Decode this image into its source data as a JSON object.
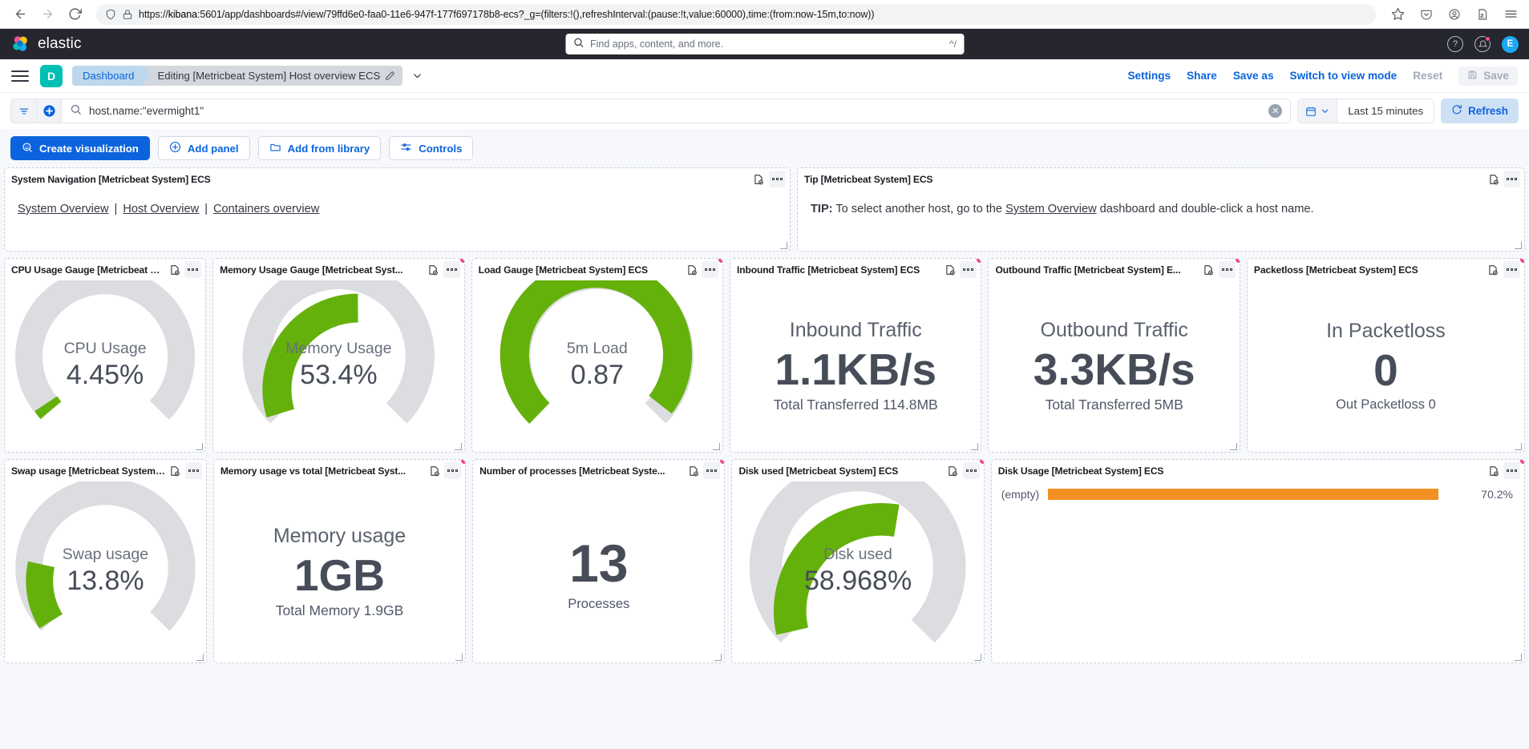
{
  "browser": {
    "url_prefix": "https://",
    "url_host": "kibana",
    "url_rest": ":5601/app/dashboards#/view/79ffd6e0-faa0-11e6-947f-177f697178b8-ecs?_g=(filters:!(),refreshInterval:(pause:!t,value:60000),time:(from:now-15m,to:now))",
    "back_icon": "back-arrow-icon",
    "forward_icon": "forward-arrow-icon",
    "reload_icon": "reload-icon",
    "shield_icon": "shield-icon",
    "lock_warning_icon": "lock-warning-icon",
    "bookmark_icon": "star-icon",
    "pocket_icon": "pocket-icon",
    "account_icon": "account-icon",
    "extensions_icon": "extensions-icon",
    "menu_icon": "hamburger-menu-icon"
  },
  "topbar": {
    "brand": "elastic",
    "search_placeholder": "Find apps, content, and more.",
    "search_shortcut": "^/",
    "help_icon": "help-circle-icon",
    "alerts_icon": "bell-icon",
    "avatar_initial": "E"
  },
  "breadcrumb": {
    "space_initial": "D",
    "first": "Dashboard",
    "last": "Editing [Metricbeat System] Host overview ECS",
    "edit_icon": "pencil-icon",
    "chevron_icon": "chevron-down-icon"
  },
  "topnav": {
    "settings": "Settings",
    "share": "Share",
    "save_as": "Save as",
    "switch_mode": "Switch to view mode",
    "reset": "Reset",
    "save": "Save",
    "save_icon": "floppy-disk-icon"
  },
  "querybar": {
    "filter_icon": "filter-icon",
    "add_filter_icon": "plus-circle-icon",
    "search_icon": "search-icon",
    "query": "host.name:\"evermight1\"",
    "clear_icon": "clear-x-icon",
    "calendar_icon": "calendar-icon",
    "date_range": "Last 15 minutes",
    "refresh_icon": "refresh-icon",
    "refresh_label": "Refresh"
  },
  "toolbar": {
    "create_visualization": "Create visualization",
    "create_icon": "lens-icon",
    "add_panel": "Add panel",
    "add_panel_icon": "plus-circle-icon",
    "add_from_library": "Add from library",
    "add_library_icon": "folder-icon",
    "controls": "Controls",
    "controls_icon": "sliders-icon"
  },
  "panel_icons": {
    "library_icon": "saved-object-icon",
    "context_menu_icon": "ellipsis-icon",
    "resize_icon": "resize-handle-icon",
    "drag_dot_icon": "drag-indicator-dot"
  },
  "colors": {
    "gauge_fill": "#65b10b",
    "gauge_track": "#dcdde1",
    "bar_fill": "#f29022",
    "accent_blue": "#0b64dd",
    "pink_dot": "#f7447f",
    "space_teal": "#00bfb3"
  },
  "panels": {
    "system_navigation": {
      "title": "System Navigation [Metricbeat System] ECS",
      "links": [
        "System Overview",
        "Host Overview",
        "Containers overview"
      ],
      "separator": "|"
    },
    "tip": {
      "title": "Tip [Metricbeat System] ECS",
      "prefix": "TIP:",
      "text_before": " To select another host, go to the ",
      "link": "System Overview",
      "text_after": " dashboard and double-click a host name."
    },
    "cpu_gauge": {
      "title": "CPU Usage Gauge [Metricbeat System] ...",
      "label": "CPU Usage",
      "value": "4.45%"
    },
    "memory_gauge": {
      "title": "Memory Usage Gauge [Metricbeat Syst...",
      "label": "Memory Usage",
      "value": "53.4%"
    },
    "load_gauge": {
      "title": "Load Gauge [Metricbeat System] ECS",
      "label": "5m Load",
      "value": "0.87"
    },
    "inbound_traffic": {
      "title": "Inbound Traffic [Metricbeat System] ECS",
      "label": "Inbound Traffic",
      "value": "1.1KB/s",
      "sub_prefix": "Total Transferred",
      "sub_value": "114.8MB"
    },
    "outbound_traffic": {
      "title": "Outbound Traffic [Metricbeat System] E...",
      "label": "Outbound Traffic",
      "value": "3.3KB/s",
      "sub_prefix": "Total Transferred",
      "sub_value": "5MB"
    },
    "packetloss": {
      "title": "Packetloss [Metricbeat System] ECS",
      "label": "In Packetloss",
      "value": "0",
      "sub": "Out Packetloss 0"
    },
    "swap_usage": {
      "title": "Swap usage [Metricbeat System] ECS",
      "label": "Swap usage",
      "value": "13.8%"
    },
    "memory_vs_total": {
      "title": "Memory usage vs total [Metricbeat Syst...",
      "label": "Memory usage",
      "value": "1GB",
      "sub_prefix": "Total Memory",
      "sub_value": "1.9GB"
    },
    "processes": {
      "title": "Number of processes [Metricbeat Syste...",
      "value": "13",
      "sub": "Processes"
    },
    "disk_used": {
      "title": "Disk used [Metricbeat System] ECS",
      "label": "Disk used",
      "value": "58.968%"
    },
    "disk_usage": {
      "title": "Disk Usage [Metricbeat System] ECS",
      "category": "(empty)",
      "percent_label": "70.2%"
    }
  },
  "chart_data": [
    {
      "type": "gauge",
      "title": "CPU Usage Gauge [Metricbeat System] ECS",
      "label": "CPU Usage",
      "value": 4.45,
      "unit": "%",
      "min": 0,
      "max": 100
    },
    {
      "type": "gauge",
      "title": "Memory Usage Gauge [Metricbeat System] ECS",
      "label": "Memory Usage",
      "value": 53.4,
      "unit": "%",
      "min": 0,
      "max": 100
    },
    {
      "type": "gauge",
      "title": "Load Gauge [Metricbeat System] ECS",
      "label": "5m Load",
      "value": 0.87,
      "unit": "",
      "min": 0,
      "max": 1
    },
    {
      "type": "gauge",
      "title": "Swap usage [Metricbeat System] ECS",
      "label": "Swap usage",
      "value": 13.8,
      "unit": "%",
      "min": 0,
      "max": 100
    },
    {
      "type": "gauge",
      "title": "Disk used [Metricbeat System] ECS",
      "label": "Disk used",
      "value": 58.968,
      "unit": "%",
      "min": 0,
      "max": 100
    },
    {
      "type": "bar",
      "orientation": "horizontal",
      "title": "Disk Usage [Metricbeat System] ECS",
      "categories": [
        "(empty)"
      ],
      "values": [
        70.2
      ],
      "xlabel": "",
      "ylabel": "",
      "xlim": [
        0,
        100
      ],
      "grid": false,
      "legend": "none"
    }
  ]
}
